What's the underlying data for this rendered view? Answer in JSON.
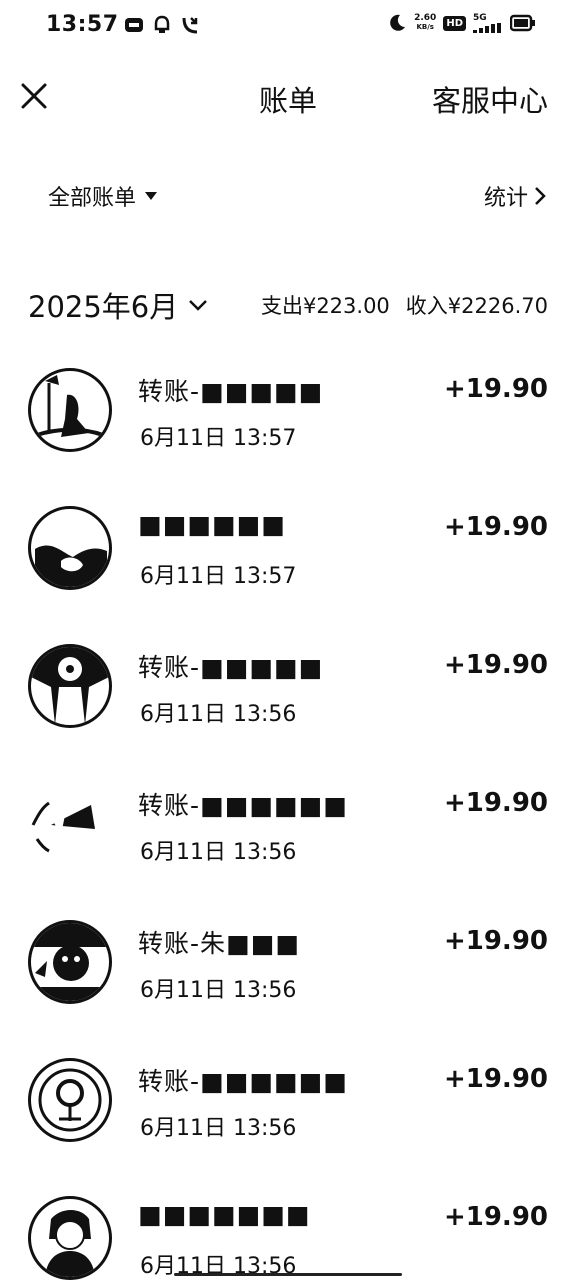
{
  "status_bar": {
    "time": "13:57",
    "net_speed_value": "2.60",
    "net_speed_unit": "KB/s",
    "hd_label": "HD",
    "network_label": "5G",
    "left_icons": [
      "app-badge-icon",
      "bell-icon",
      "missed-call-icon"
    ],
    "right_icons": [
      "moon-icon",
      "signal-icon",
      "battery-icon"
    ]
  },
  "nav": {
    "title": "账单",
    "right_label": "客服中心",
    "close_icon": "close-icon"
  },
  "filter": {
    "all_bills_label": "全部账单",
    "stats_label": "统计"
  },
  "month": {
    "label": "2025年6月",
    "expense": "支出¥223.00",
    "income": "收入¥2226.70"
  },
  "transactions": [
    {
      "name": "转账-■■■■■",
      "time": "6月11日 13:57",
      "amount": "+19.90"
    },
    {
      "name": "■■■■■■",
      "time": "6月11日 13:57",
      "amount": "+19.90"
    },
    {
      "name": "转账-■■■■■",
      "time": "6月11日 13:56",
      "amount": "+19.90"
    },
    {
      "name": "转账-■■■■■■",
      "time": "6月11日 13:56",
      "amount": "+19.90"
    },
    {
      "name": "转账-朱■■■",
      "time": "6月11日 13:56",
      "amount": "+19.90"
    },
    {
      "name": "转账-■■■■■■",
      "time": "6月11日 13:56",
      "amount": "+19.90"
    },
    {
      "name": "■■■■■■■",
      "time": "6月11日 13:56",
      "amount": "+19.90"
    }
  ]
}
